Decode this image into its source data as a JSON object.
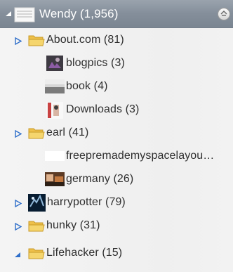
{
  "tree": {
    "root": {
      "label": "Wendy (1,956)",
      "icon": "collection-icon",
      "expanded": true
    },
    "items": [
      {
        "label": "About.com (81)",
        "icon": "folder-icon",
        "has_children": true
      },
      {
        "label": "blogpics (3)",
        "icon": "image-thumbnail-icon",
        "has_children": false
      },
      {
        "label": "book (4)",
        "icon": "image-thumbnail-icon",
        "has_children": false
      },
      {
        "label": "Downloads (3)",
        "icon": "image-thumbnail-icon",
        "has_children": false
      },
      {
        "label": "earl (41)",
        "icon": "folder-icon",
        "has_children": true
      },
      {
        "label": "freepremademyspacelayou…",
        "icon": "blank-image-icon",
        "has_children": false
      },
      {
        "label": "germany (26)",
        "icon": "image-thumbnail-icon",
        "has_children": false
      },
      {
        "label": "harrypotter (79)",
        "icon": "image-thumbnail-icon",
        "has_children": true
      },
      {
        "label": "hunky (31)",
        "icon": "folder-icon",
        "has_children": true
      },
      {
        "label": "Lifehacker (15)",
        "icon": "folder-icon",
        "has_children": true,
        "expanded": true
      }
    ]
  },
  "colors": {
    "header_bg": "#858f9b",
    "panel_bg": "#f3f3f3",
    "folder_yellow": "#f0c54d",
    "arrow_blue": "#2f6fca",
    "text": "#2f2f2f"
  }
}
